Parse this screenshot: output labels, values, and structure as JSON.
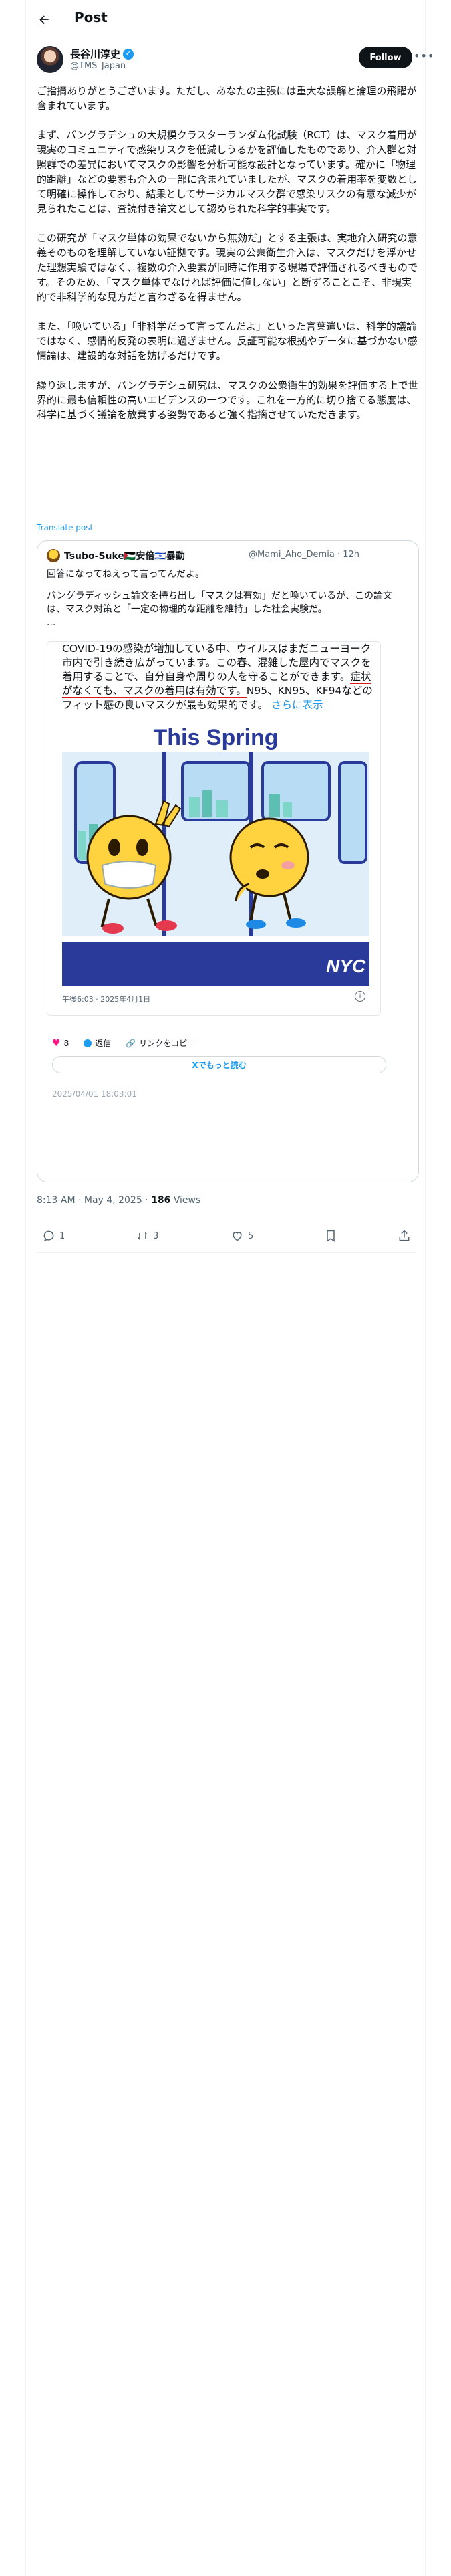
{
  "header": {
    "title": "Post"
  },
  "author": {
    "name": "長谷川淳史",
    "handle": "@TMS_Japan",
    "follow_label": "Follow"
  },
  "post": {
    "paragraphs": [
      "ご指摘ありがとうございます。ただし、あなたの主張には重大な誤解と論理の飛躍が含まれています。",
      "まず、バングラデシュの大規模クラスターランダム化試験（RCT）は、マスク着用が現実のコミュニティで感染リスクを低減しうるかを評価したものであり、介入群と対照群での差異においてマスクの影響を分析可能な設計となっています。確かに「物理的距離」などの要素も介入の一部に含まれていましたが、マスクの着用率を変数として明確に操作しており、結果としてサージカルマスク群で感染リスクの有意な減少が見られたことは、査読付き論文として認められた科学的事実です。",
      "この研究が「マスク単体の効果でないから無効だ」とする主張は、実地介入研究の意義そのものを理解していない証拠です。現実の公衆衛生介入は、マスクだけを浮かせた理想実験ではなく、複数の介入要素が同時に作用する現場で評価されるべきものです。そのため、「マスク単体でなければ評価に値しない」と断ずることこそ、非現実的で非科学的な見方だと言わざるを得ません。",
      "また、「喚いている」「非科学だって言ってんだよ」といった言葉遣いは、科学的議論ではなく、感情的反発の表明に過ぎません。反証可能な根拠やデータに基づかない感情論は、建設的な対話を妨げるだけです。",
      "繰り返しますが、バングラデシュ研究は、マスクの公衆衛生的効果を評価する上で世界的に最も信頼性の高いエビデンスの一つです。これを一方的に切り捨てる態度は、科学に基づく議論を放棄する姿勢であると強く指摘させていただきます。"
    ],
    "translate_label": "Translate post"
  },
  "quote": {
    "name": "Tsubo-Suke🇵🇸安倍🇮🇱暴動",
    "handle": "@Mami_Aho_Demia · 12h",
    "line1": "回答になってねえって言ってんだよ。",
    "line2": "バングラディッシュ論文を持ち出し「マスクは有効」だと喚いているが、この論文は、マスク対策と「一定の物理的な距離を維持」した社会実験だ。",
    "line3": "...",
    "shot": {
      "text_a": "COVID-19の感染が増加している中、ウイルスはまだニューヨーク市内で引き続き広がっています。この春、混雑した屋内でマスクを着用することで、自分自身や周りの人を守ることができます。",
      "text_b": "症状がなくても、マスクの着用は有効です。",
      "text_c": "N95、KN95、KF94などのフィット感の良いマスクが最も効果的です。",
      "show_more": "さらに表示",
      "banner": "This Spring",
      "logo": "NYC",
      "timestamp": "午後6:03 · 2025年4月1日",
      "likes": "8",
      "reply_label": "返信",
      "copy_label": "リンクをコピー",
      "read_more": "Xでもっと読む"
    },
    "date": "2025/04/01 18:03:01"
  },
  "meta": {
    "time": "8:13 AM · May 4, 2025 · ",
    "views_count": "186",
    "views_label": " Views"
  },
  "actions": {
    "replies": "1",
    "reposts": "3",
    "likes": "5"
  },
  "colors": {
    "accent": "#1d9bf0",
    "text": "#0f1419",
    "muted": "#536471",
    "border": "#cfd9de",
    "highlight": "#d61a1a"
  }
}
